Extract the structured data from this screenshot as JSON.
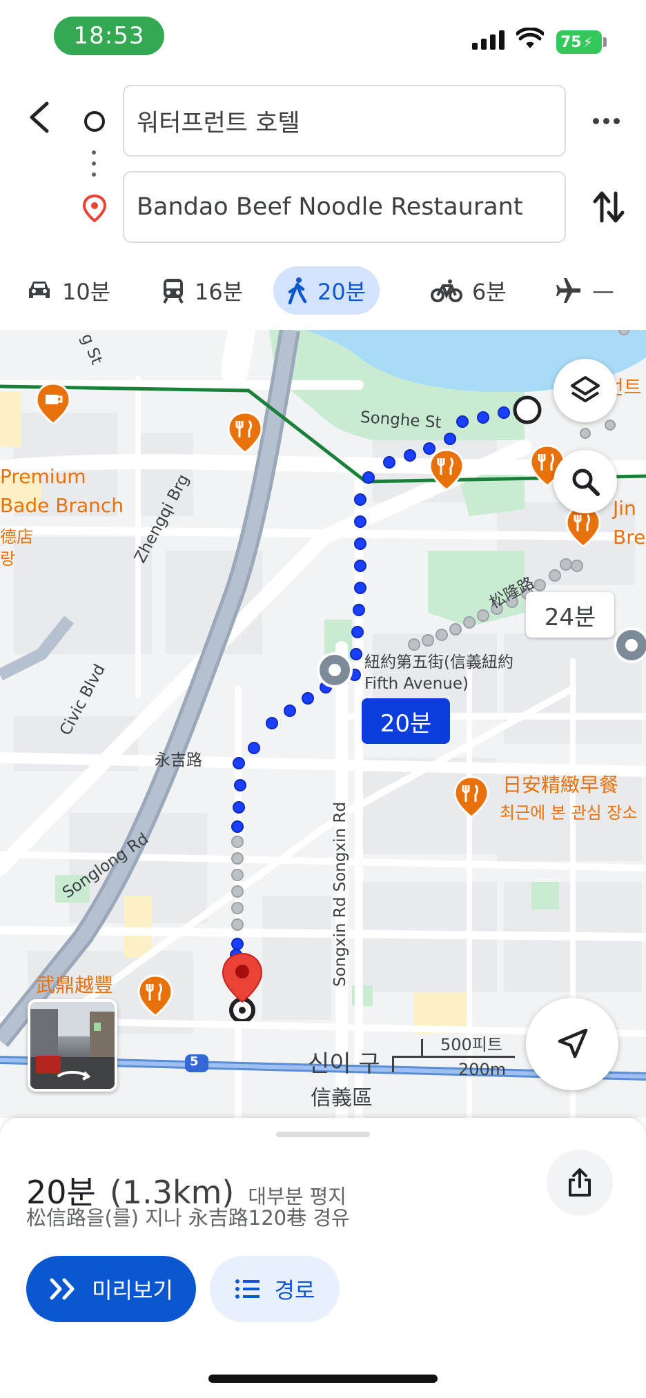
{
  "status": {
    "time": "18:53",
    "battery": "75"
  },
  "search": {
    "origin": "워터프런트 호텔",
    "destination": "Bandao Beef Noodle Restaurant"
  },
  "modes": [
    {
      "label": "10분",
      "icon": "car-icon"
    },
    {
      "label": "16분",
      "icon": "transit-icon"
    },
    {
      "label": "20분",
      "icon": "walk-icon",
      "active": true
    },
    {
      "label": "6분",
      "icon": "bike-icon"
    },
    {
      "label": "—",
      "icon": "flight-icon"
    }
  ],
  "map": {
    "labels": {
      "songhe": "Songhe St",
      "zhengqi": "Zhengqi Brg",
      "civic": "Civic Blvd",
      "yongji": "永吉路",
      "songlong": "Songlong Rd",
      "songxin": "Songxin Rd Songxin Rd",
      "songlong_zh": "松隆路",
      "fifth_ave": "紐約第五街(信義紐約",
      "fifth_ave2": "Fifth Avenue)",
      "premium": "Premium",
      "bade": "Bade Branch",
      "sub1": "德店",
      "sub2": "랑",
      "g_st": "g St",
      "jin": "Jin",
      "bre": "Bre",
      "riant": "日安精緻早餐",
      "recent": "최근에 본 관심 장소",
      "wuding": "武鼎越豐",
      "district_ko": "신이 구",
      "district_zh": "信義區",
      "top_right": "런트",
      "route5": "5"
    },
    "scale": {
      "imperial": "500피트",
      "metric": "200m"
    },
    "route_time": "20분",
    "alt_route_time": "24분"
  },
  "sheet": {
    "duration": "20분",
    "distance": "(1.3km)",
    "terrain": "대부분 평지",
    "via": "松信路을(를) 지나 永吉路120巷 경유",
    "preview_label": "미리보기",
    "steps_label": "경로"
  },
  "colors": {
    "route": "#1a3fff",
    "accent": "#0b57d0",
    "poi": "#e8710a",
    "pin": "#ea4335",
    "park": "#c8ebd1",
    "water": "#a8dbf5"
  }
}
